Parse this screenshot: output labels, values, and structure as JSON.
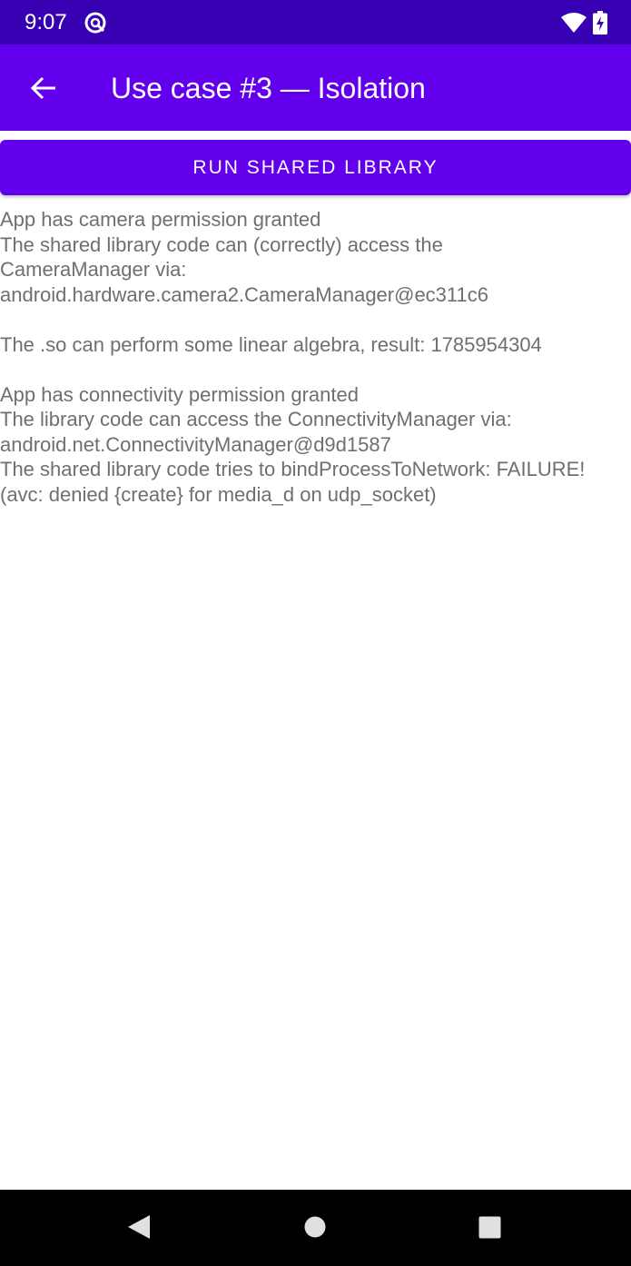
{
  "status_bar": {
    "time": "9:07",
    "icons": [
      "notification-icon",
      "wifi-icon",
      "battery-charging-icon"
    ]
  },
  "app_bar": {
    "back_icon": "arrow-left-icon",
    "title": "Use case #3 — Isolation"
  },
  "main": {
    "run_button_label": "RUN SHARED LIBRARY",
    "output_lines": [
      "App has camera permission granted",
      "The shared library code can (correctly) access the",
      "CameraManager via:",
      "android.hardware.camera2.CameraManager@ec311c6",
      "",
      "The .so can perform some linear algebra, result: 1785954304",
      "",
      "App has connectivity permission granted",
      "The library code can access the ConnectivityManager via:",
      "android.net.ConnectivityManager@d9d1587",
      "The shared library code tries to bindProcessToNetwork: FAILURE!",
      "(avc: denied {create} for media_d on udp_socket)"
    ]
  },
  "nav_bar": {
    "icons": [
      "nav-back-icon",
      "nav-home-icon",
      "nav-recents-icon"
    ]
  },
  "colors": {
    "status_bar": "#3700b3",
    "primary": "#6200ee",
    "text_secondary": "#6f6f6f",
    "nav_bar": "#000000"
  }
}
